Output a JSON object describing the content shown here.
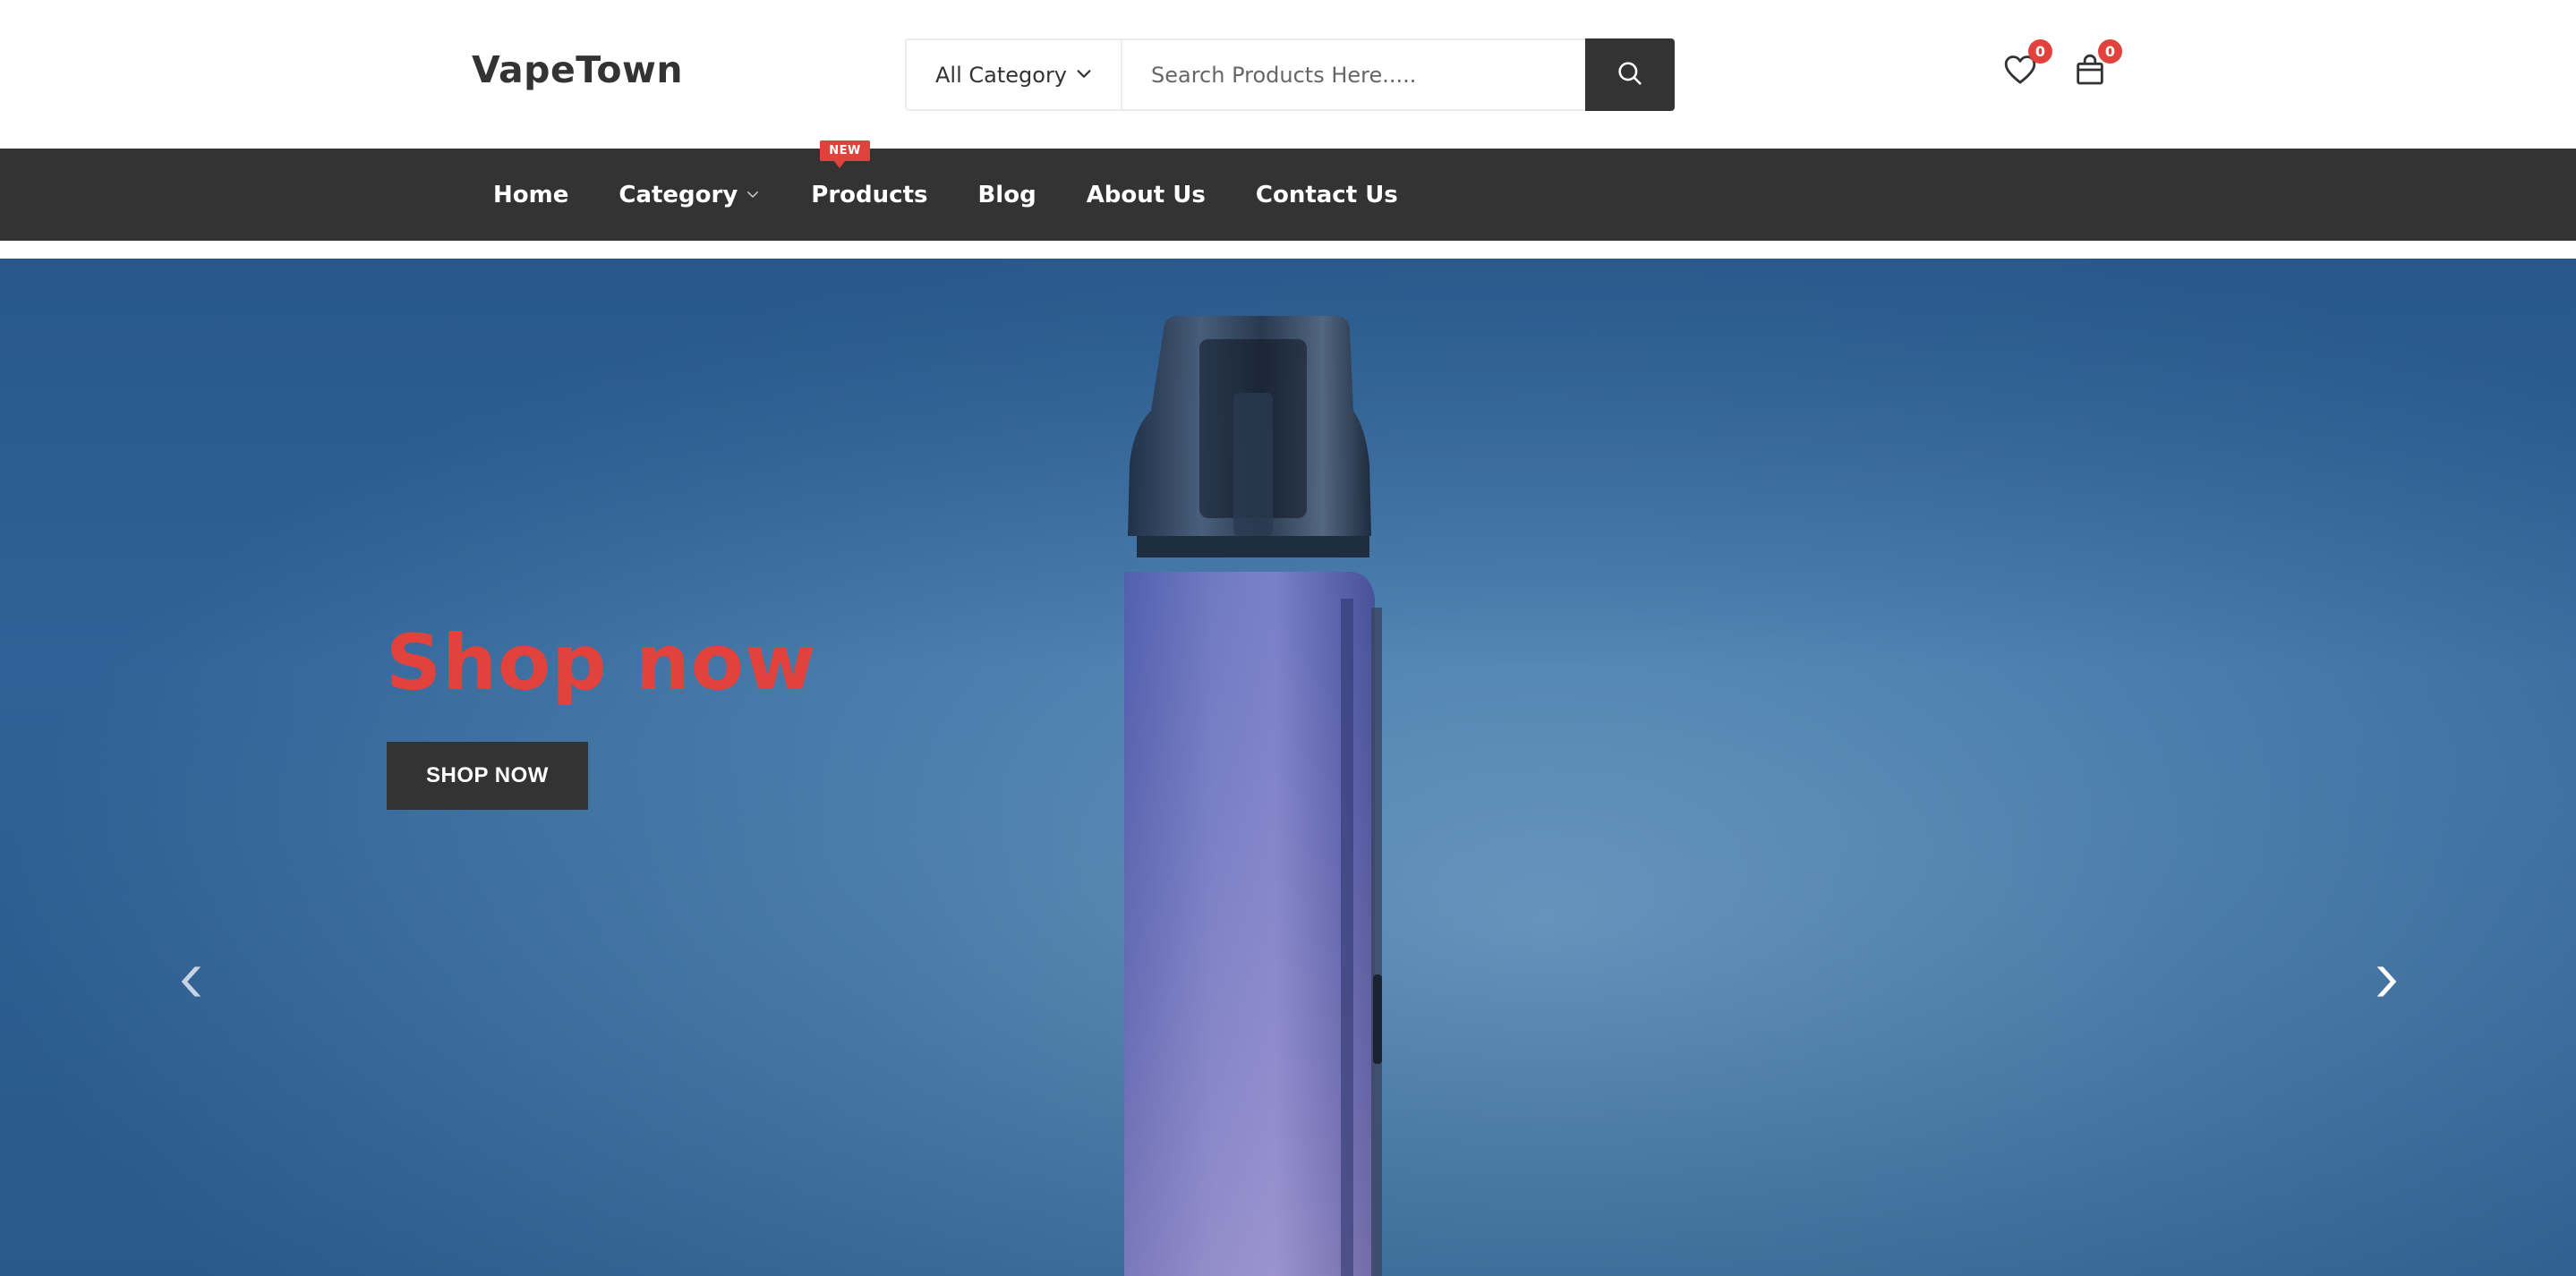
{
  "header": {
    "logo": "VapeTown",
    "search": {
      "category_label": "All Category",
      "placeholder": "Search Products Here....."
    },
    "wishlist_count": "0",
    "cart_count": "0"
  },
  "nav": {
    "items": [
      {
        "label": "Home"
      },
      {
        "label": "Category",
        "has_dropdown": true
      },
      {
        "label": "Products",
        "badge": "NEW"
      },
      {
        "label": "Blog"
      },
      {
        "label": "About Us"
      },
      {
        "label": "Contact Us"
      }
    ]
  },
  "hero": {
    "headline": "Shop now",
    "cta_label": "SHOP NOW"
  },
  "colors": {
    "brand_dark": "#333333",
    "accent_red": "#e1433c",
    "hero_blue": "#4f82b0"
  },
  "icons": [
    "chevron-down-icon",
    "search-icon",
    "heart-icon",
    "shopping-bag-icon",
    "chevron-left-icon",
    "chevron-right-icon"
  ]
}
